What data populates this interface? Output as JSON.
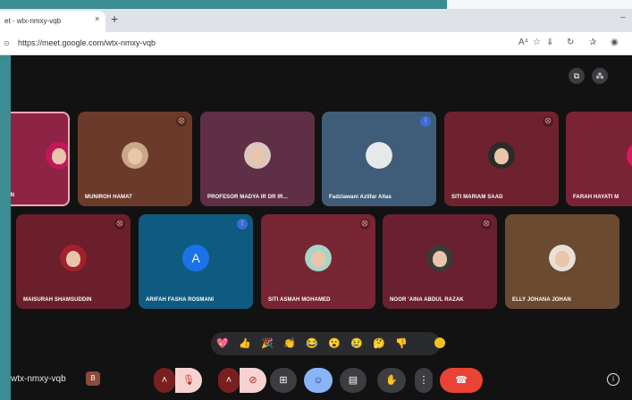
{
  "browser": {
    "tab_title": "et - wtx-nmxy-vqb",
    "tab_close": "×",
    "new_tab": "+",
    "minimize": "–",
    "url": "https://meet.google.com/wtx-nmxy-vqb",
    "lock_glyph": "⊙",
    "toolbar_icons": [
      "read-aloud-icon",
      "favorite-icon",
      "download-icon",
      "sync-icon",
      "favorites-bar-icon",
      "profile-icon"
    ],
    "toolbar_glyphs": [
      "A⁴",
      "☆",
      "⇓",
      "↻",
      "✰",
      "◉"
    ]
  },
  "meet": {
    "top_icons": [
      "present-icon",
      "participants-icon"
    ],
    "top_glyphs": [
      "⧉",
      "⁂"
    ],
    "row1": [
      {
        "name": "IN",
        "mic": "off",
        "bg": "#8f2346"
      },
      {
        "name": "MUNIROH HAMAT",
        "mic": "off",
        "bg": "#6b3a2a"
      },
      {
        "name": "PROFESOR MADYA IR DR IR...",
        "mic": "none",
        "bg": "#5e2f45"
      },
      {
        "name": "Fadzlawani Azlifar Allas",
        "mic": "on",
        "bg": "#3f5d78"
      },
      {
        "name": "SITI MARIAM SAAD",
        "mic": "off",
        "bg": "#6e2230"
      },
      {
        "name": "FARAH HAYATI M",
        "mic": "none",
        "bg": "#7a2236"
      }
    ],
    "row2": [
      {
        "name": "MAISURAH SHAMSUDDIN",
        "mic": "off",
        "bg": "#6a1f2a"
      },
      {
        "name": "ARIFAH FASHA ROSMANI",
        "mic": "on",
        "bg": "#0f5a80",
        "letter": "A"
      },
      {
        "name": "SITI ASMAH MOHAMED",
        "mic": "off",
        "bg": "#782534"
      },
      {
        "name": "NOOR 'AINA ABDUL RAZAK",
        "mic": "off",
        "bg": "#6a2030"
      },
      {
        "name": "ELLY JOHANA JOHAN",
        "mic": "none",
        "bg": "#6b4a32"
      }
    ],
    "mic_off_glyph": "⨂",
    "mic_on_glyph": "⋮",
    "reactions": [
      "💖",
      "👍",
      "🎉",
      "👏",
      "😂",
      "😮",
      "😢",
      "🤔",
      "👎"
    ],
    "meeting_code": "wtx-nmxy-vqb",
    "controls": {
      "mic_arrow": "˄",
      "mic": "🎙",
      "cam_arrow": "˄",
      "cam": "⊘",
      "present": "⊞",
      "emoji": "☺",
      "captions": "▤",
      "raise_hand": "✋",
      "more": "⋮",
      "end_call": "☎",
      "info": "i"
    },
    "code_icon_glyph": "B"
  }
}
